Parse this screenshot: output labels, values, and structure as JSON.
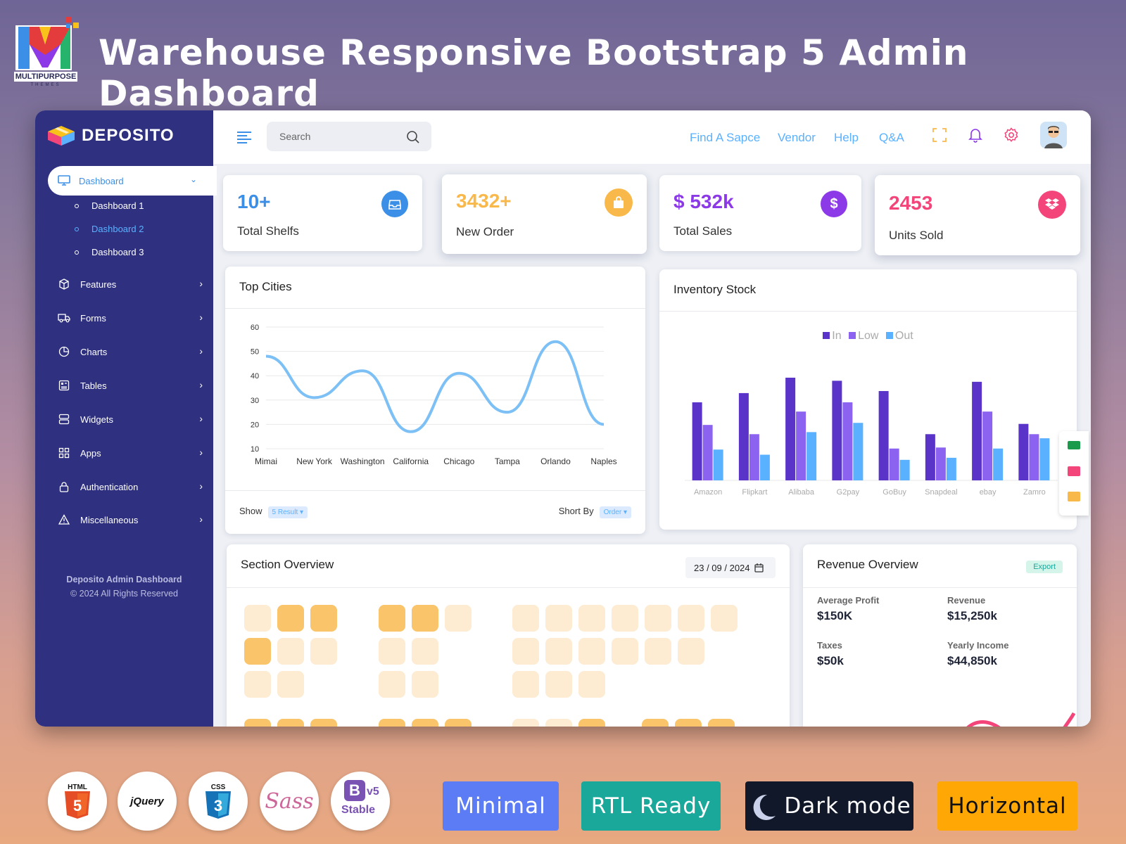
{
  "banner": {
    "title": "Warehouse Responsive Bootstrap 5 Admin Dashboard",
    "brand_line1": "MULTIPURPOSE",
    "brand_line2": "THEMES"
  },
  "app": {
    "name": "DEPOSITO"
  },
  "sidebar": {
    "active": {
      "label": "Dashboard"
    },
    "subitems": [
      {
        "label": "Dashboard 1"
      },
      {
        "label": "Dashboard 2"
      },
      {
        "label": "Dashboard 3"
      }
    ],
    "items": [
      {
        "label": "Features",
        "icon": "box-icon"
      },
      {
        "label": "Forms",
        "icon": "truck-icon"
      },
      {
        "label": "Charts",
        "icon": "pie-chart-icon"
      },
      {
        "label": "Tables",
        "icon": "table-icon"
      },
      {
        "label": "Widgets",
        "icon": "server-icon"
      },
      {
        "label": "Apps",
        "icon": "grid-icon"
      },
      {
        "label": "Authentication",
        "icon": "lock-icon"
      },
      {
        "label": "Miscellaneous",
        "icon": "alert-triangle-icon"
      }
    ],
    "footer_title": "Deposito Admin Dashboard",
    "footer_copy": "© 2024 All Rights Reserved"
  },
  "topbar": {
    "search_placeholder": "Search",
    "links": [
      "Find A Sapce",
      "Vendor",
      "Help",
      "Q&A"
    ]
  },
  "stats": [
    {
      "value": "10+",
      "label": "Total Shelfs",
      "color": "#3b8fe6",
      "icon": "inbox-icon"
    },
    {
      "value": "3432+",
      "label": "New Order",
      "color": "#f9b84a",
      "icon": "shopping-bag-icon"
    },
    {
      "value": "$ 532k",
      "label": "Total Sales",
      "color": "#8c39e8",
      "icon": "dollar-icon"
    },
    {
      "value": "2453",
      "label": "Units Sold",
      "color": "#f3457a",
      "icon": "dropbox-icon"
    }
  ],
  "top_cities": {
    "title": "Top Cities",
    "show_label": "Show",
    "show_value": "5 Result",
    "sort_label": "Short By",
    "sort_value": "Order"
  },
  "inventory": {
    "title": "Inventory Stock"
  },
  "section_overview": {
    "title": "Section Overview",
    "date": "23 / 09 / 2024"
  },
  "revenue": {
    "title": "Revenue Overview",
    "export_label": "Export",
    "metrics": [
      {
        "label": "Average Profit",
        "value": "$150K"
      },
      {
        "label": "Revenue",
        "value": "$15,250k"
      },
      {
        "label": "Taxes",
        "value": "$50k"
      },
      {
        "label": "Yearly Income",
        "value": "$44,850k"
      }
    ]
  },
  "tech_badges": [
    "HTML",
    "jQuery",
    "CSS",
    "Sass",
    "v5",
    "Stable"
  ],
  "features": [
    {
      "label": "Minimal",
      "color": "#5b7cf5"
    },
    {
      "label": "RTL Ready",
      "color": "#1aa89a"
    },
    {
      "label": "Dark mode",
      "color": "#11182a"
    },
    {
      "label": "Horizontal",
      "color": "#ffa704"
    }
  ],
  "chart_data": [
    {
      "type": "line",
      "title": "Top Cities",
      "categories": [
        "Mimai",
        "New York",
        "Washington",
        "California",
        "Chicago",
        "Tampa",
        "Orlando",
        "Naples"
      ],
      "series": [
        {
          "values": [
            48,
            31,
            42,
            17,
            41,
            25,
            54,
            20
          ]
        }
      ],
      "ylim": [
        10,
        60
      ],
      "yticks": [
        10,
        20,
        30,
        40,
        50,
        60
      ],
      "grid": true,
      "color": "#7cc0f5"
    },
    {
      "type": "bar",
      "title": "Inventory Stock",
      "categories": [
        "Amazon",
        "Flipkart",
        "Alibaba",
        "G2pay",
        "GoBuy",
        "Snapdeal",
        "ebay",
        "Zamro"
      ],
      "series": [
        {
          "name": "In",
          "color": "#5a33c9",
          "values": [
            76,
            85,
            100,
            97,
            87,
            45,
            96,
            55
          ]
        },
        {
          "name": "Low",
          "color": "#8c63f0",
          "values": [
            54,
            45,
            67,
            76,
            31,
            32,
            67,
            45
          ]
        },
        {
          "name": "Out",
          "color": "#5ab1ff",
          "values": [
            30,
            25,
            47,
            56,
            20,
            22,
            31,
            41
          ]
        }
      ],
      "legend": "top-center"
    }
  ]
}
